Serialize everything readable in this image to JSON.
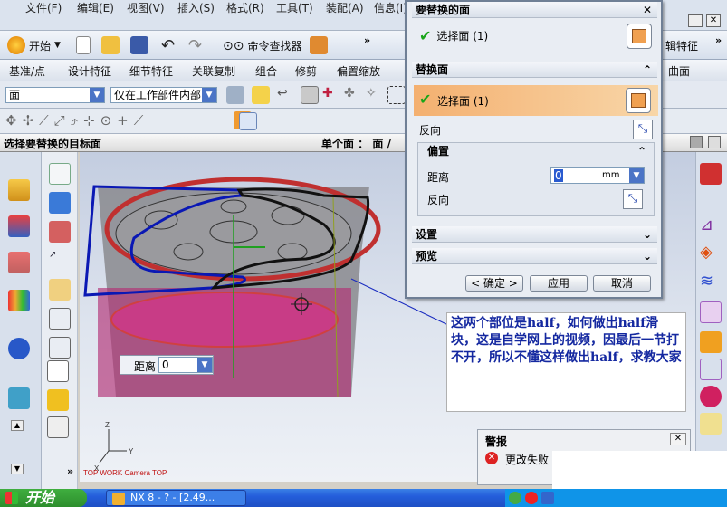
{
  "menubar": {
    "items": [
      "文件(F)",
      "编辑(E)",
      "视图(V)",
      "插入(S)",
      "格式(R)",
      "工具(T)",
      "装配(A)",
      "信息(I)"
    ]
  },
  "toolbar1": {
    "start_label": "开始",
    "command_finder": "命令查找器",
    "right_label": "辑特征"
  },
  "toolbar2": {
    "items": [
      "基准/点",
      "设计特征",
      "细节特征",
      "关联复制",
      "组合",
      "修剪",
      "偏置缩放"
    ],
    "right_item": "曲面"
  },
  "toolbar3": {
    "filter_value": "面",
    "scope_value": "仅在工作部件内部"
  },
  "cue": {
    "prompt": "选择要替换的目标面",
    "status": "单个面 ： 面 /"
  },
  "dialog": {
    "section1_title": "要替换的面",
    "select1_label": "选择面 (1)",
    "section2_title": "替换面",
    "select2_label": "选择面 (1)",
    "reverse_label": "反向",
    "offset_title": "偏置",
    "distance_label": "距离",
    "distance_value": "0",
    "distance_unit": "mm",
    "offset_reverse_label": "反向",
    "settings_title": "设置",
    "preview_title": "预览",
    "ok_label": "< 确定 >",
    "apply_label": "应用",
    "cancel_label": "取消"
  },
  "viewport": {
    "distance_label": "距离",
    "distance_value": "0",
    "view_caption": "TOP WORK Camera TOP"
  },
  "callout": {
    "text": "这两个部位是half，如何做出half滑块，这是自学网上的视频，因最后一节打不开，所以不懂这样做出half，求教大家"
  },
  "alert": {
    "title": "警报",
    "message": "更改失败"
  },
  "taskbar": {
    "start_label": "开始",
    "task_label": "NX 8 - ? - [2.49..."
  },
  "colors": {
    "accent": "#f0a050",
    "check": "#19a519",
    "part_magenta": "#b0206a",
    "sketch_blue": "#0a18b4"
  }
}
